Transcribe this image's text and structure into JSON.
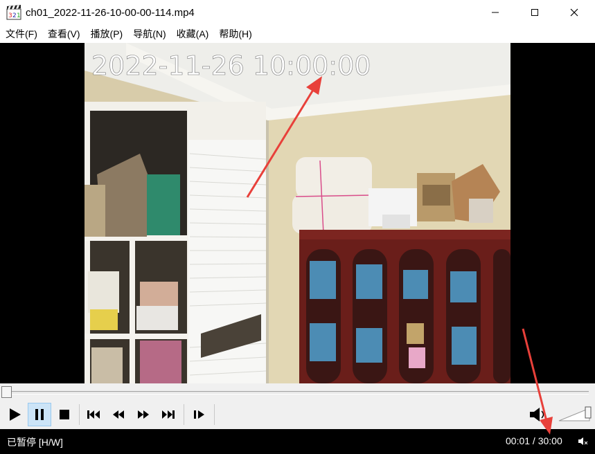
{
  "window": {
    "title": "ch01_2022-11-26-10-00-00-114.mp4",
    "app_icon": "film-clapper-icon",
    "buttons": [
      "minimize-icon",
      "maximize-icon",
      "close-icon"
    ]
  },
  "menu": {
    "items": [
      {
        "label": "文件(F)"
      },
      {
        "label": "查看(V)"
      },
      {
        "label": "播放(P)"
      },
      {
        "label": "导航(N)"
      },
      {
        "label": "收藏(A)"
      },
      {
        "label": "帮助(H)"
      }
    ]
  },
  "video": {
    "osd_timestamp": "2022-11-26  10:00:00"
  },
  "seek": {
    "position_fraction": 0.0
  },
  "controls": {
    "buttons": [
      {
        "name": "play-button",
        "icon": "play-icon",
        "active": false
      },
      {
        "name": "pause-button",
        "icon": "pause-icon",
        "active": true
      },
      {
        "name": "stop-button",
        "icon": "stop-icon",
        "active": false
      },
      {
        "name": "previous-button",
        "icon": "skip-back-icon",
        "active": false
      },
      {
        "name": "rewind-button",
        "icon": "rewind-icon",
        "active": false
      },
      {
        "name": "fast-forward-button",
        "icon": "fast-forward-icon",
        "active": false
      },
      {
        "name": "next-button",
        "icon": "skip-forward-icon",
        "active": false
      },
      {
        "name": "frame-step-button",
        "icon": "frame-step-icon",
        "active": false
      }
    ],
    "volume_level": 1.0
  },
  "status": {
    "state": "已暂停 [H/W]",
    "time": "00:01 / 30:00"
  },
  "colors": {
    "annotation_arrow": "#e8403a",
    "active_button": "#cce4f7",
    "status_bg": "#000000"
  }
}
